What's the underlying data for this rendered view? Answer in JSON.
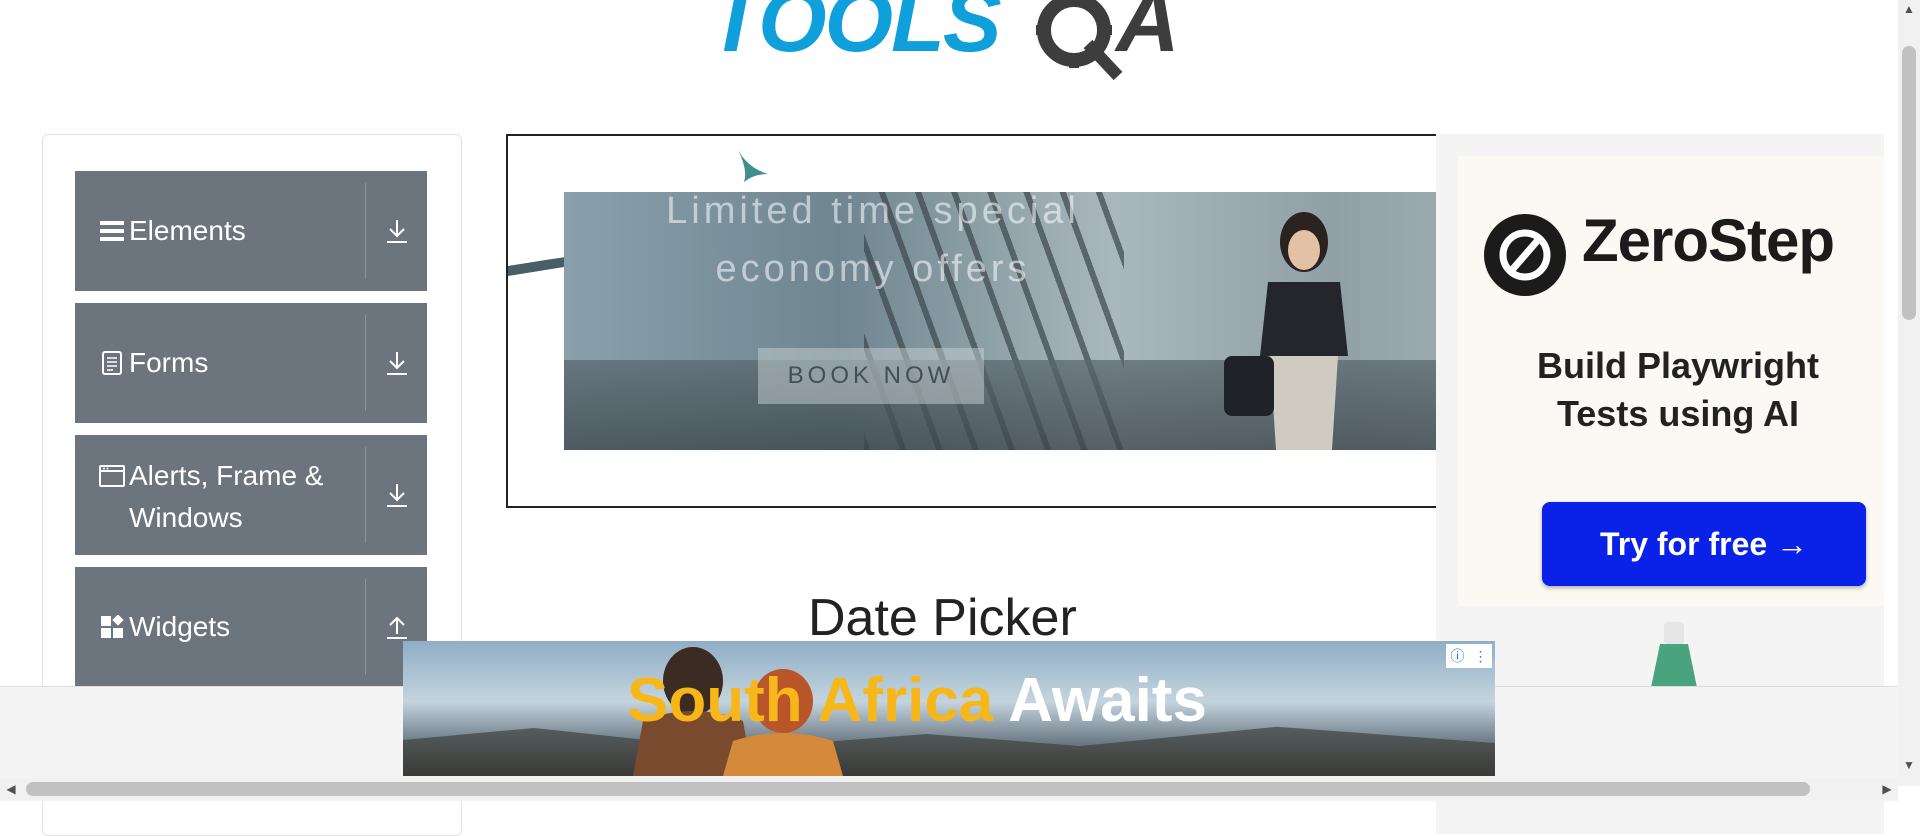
{
  "logo": {
    "text_left": "TOOLS",
    "text_right": "A"
  },
  "sidebar": {
    "groups": [
      {
        "label": "Elements",
        "icon": "hamburger-icon",
        "toggle_icon": "download-arrow-icon"
      },
      {
        "label": "Forms",
        "icon": "document-icon",
        "toggle_icon": "download-arrow-icon"
      },
      {
        "label": "Alerts, Frame & Windows",
        "icon": "window-icon",
        "toggle_icon": "download-arrow-icon"
      },
      {
        "label": "Widgets",
        "icon": "widgets-icon",
        "toggle_icon": "upload-arrow-icon"
      }
    ]
  },
  "banner_ad": {
    "offer_line1": "Limited time special",
    "offer_line2": "economy offers",
    "cta": "BOOK NOW"
  },
  "right_ad": {
    "brand": "ZeroStep",
    "tagline": "Build Playwright Tests using AI",
    "cta": "Try for free →"
  },
  "main": {
    "title": "Date Picker"
  },
  "bottom_ad": {
    "headline_part1": "South Africa",
    "headline_part2": "Awaits"
  },
  "colors": {
    "sidebar_bg": "#6c757d",
    "logo_blue": "#0fa0dc",
    "cta_blue": "#0a22e8",
    "ad_yellow": "#f7b719"
  }
}
